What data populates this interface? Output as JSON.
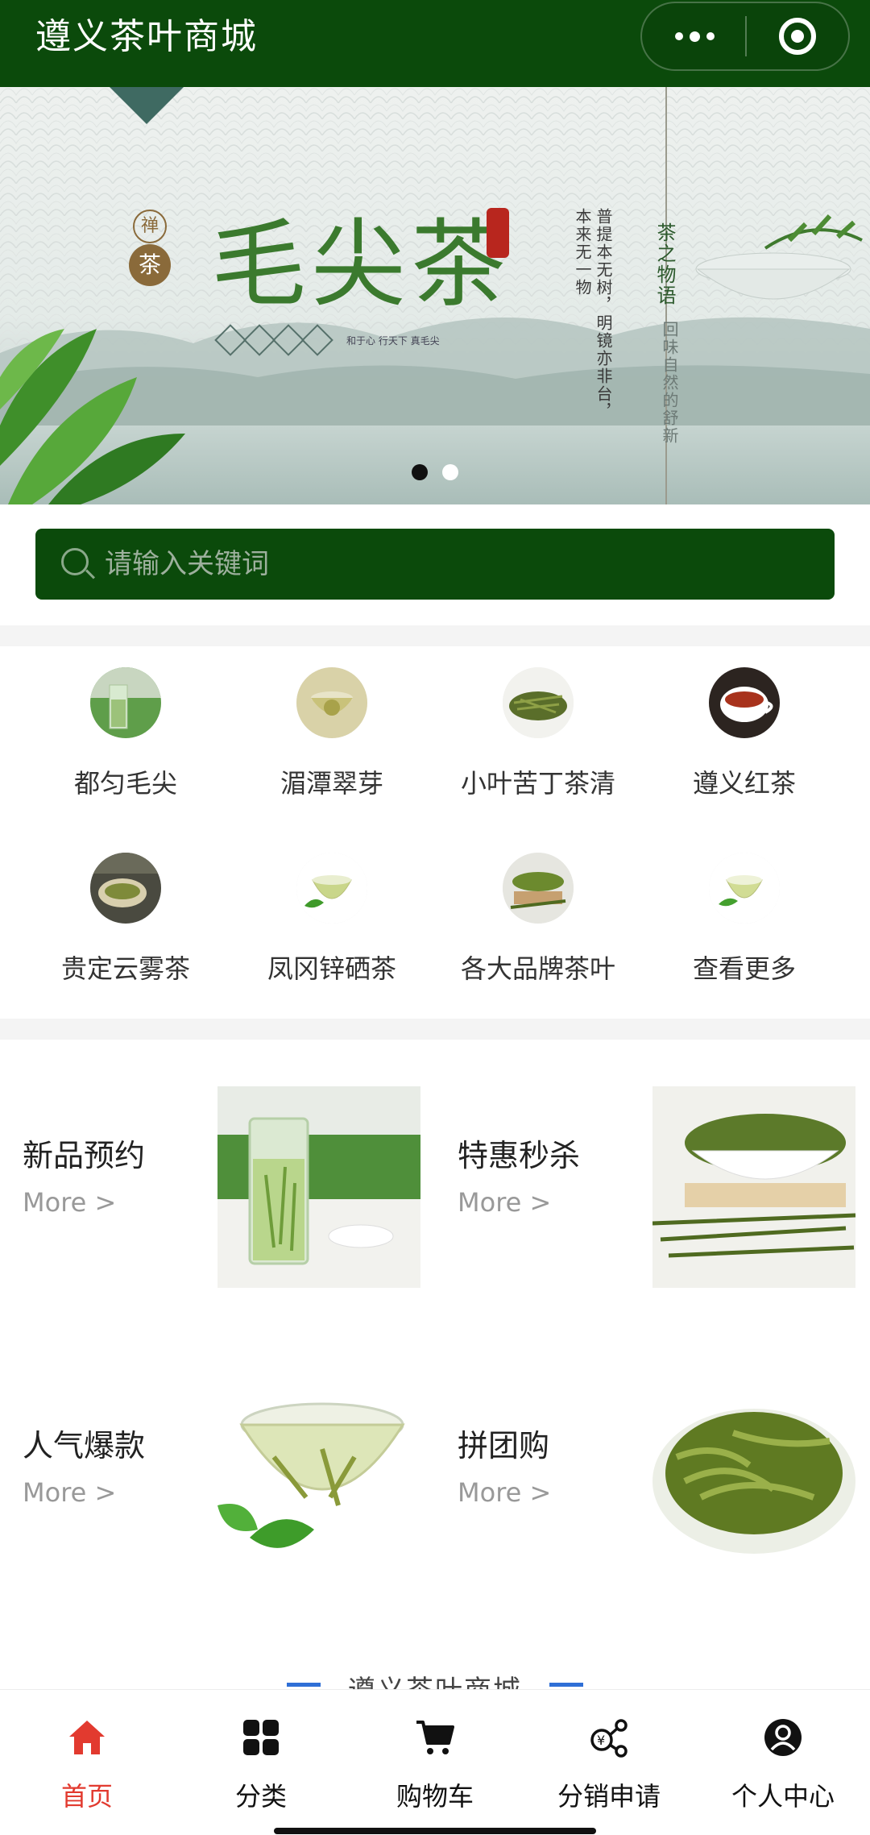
{
  "app": {
    "title": "遵义茶叶商城"
  },
  "banner": {
    "seal_zen": "禅",
    "seal_cha": "茶",
    "headline": "毛尖茶",
    "tagline": "和于心 行天下 真毛尖",
    "vertical_1": "普提本无树，明镜亦非台，本来无一物",
    "vertical_2": "茶之物语",
    "vertical_3": "回味自然的舒新",
    "slides": 2,
    "active_slide": 1
  },
  "search": {
    "placeholder": "请输入关键词"
  },
  "categories": [
    {
      "label": "都匀毛尖",
      "icon": "tea-glass-icon"
    },
    {
      "label": "湄潭翠芽",
      "icon": "tea-cup-icon"
    },
    {
      "label": "小叶苦丁茶清",
      "icon": "tea-leaves-icon"
    },
    {
      "label": "遵义红茶",
      "icon": "black-tea-icon"
    },
    {
      "label": "贵定云雾茶",
      "icon": "tea-spoon-icon"
    },
    {
      "label": "凤冈锌硒茶",
      "icon": "tea-cup-icon"
    },
    {
      "label": "各大品牌茶叶",
      "icon": "tea-bowl-icon"
    },
    {
      "label": "查看更多",
      "icon": "tea-cup-icon"
    }
  ],
  "promos": [
    {
      "title": "新品预约",
      "more": "More >"
    },
    {
      "title": "特惠秒杀",
      "more": "More >"
    },
    {
      "title": "人气爆款",
      "more": "More >"
    },
    {
      "title": "拼团购",
      "more": "More >"
    }
  ],
  "footer_mark": "遵义茶叶商城",
  "tabbar": [
    {
      "label": "首页",
      "icon": "home-icon",
      "active": true
    },
    {
      "label": "分类",
      "icon": "grid-icon",
      "active": false
    },
    {
      "label": "购物车",
      "icon": "cart-icon",
      "active": false
    },
    {
      "label": "分销申请",
      "icon": "share-icon",
      "active": false
    },
    {
      "label": "个人中心",
      "icon": "user-icon",
      "active": false
    }
  ],
  "colors": {
    "brand_green": "#0b4a0b",
    "active_tab": "#e23a2f",
    "divider_blue": "#2f6fd6"
  }
}
